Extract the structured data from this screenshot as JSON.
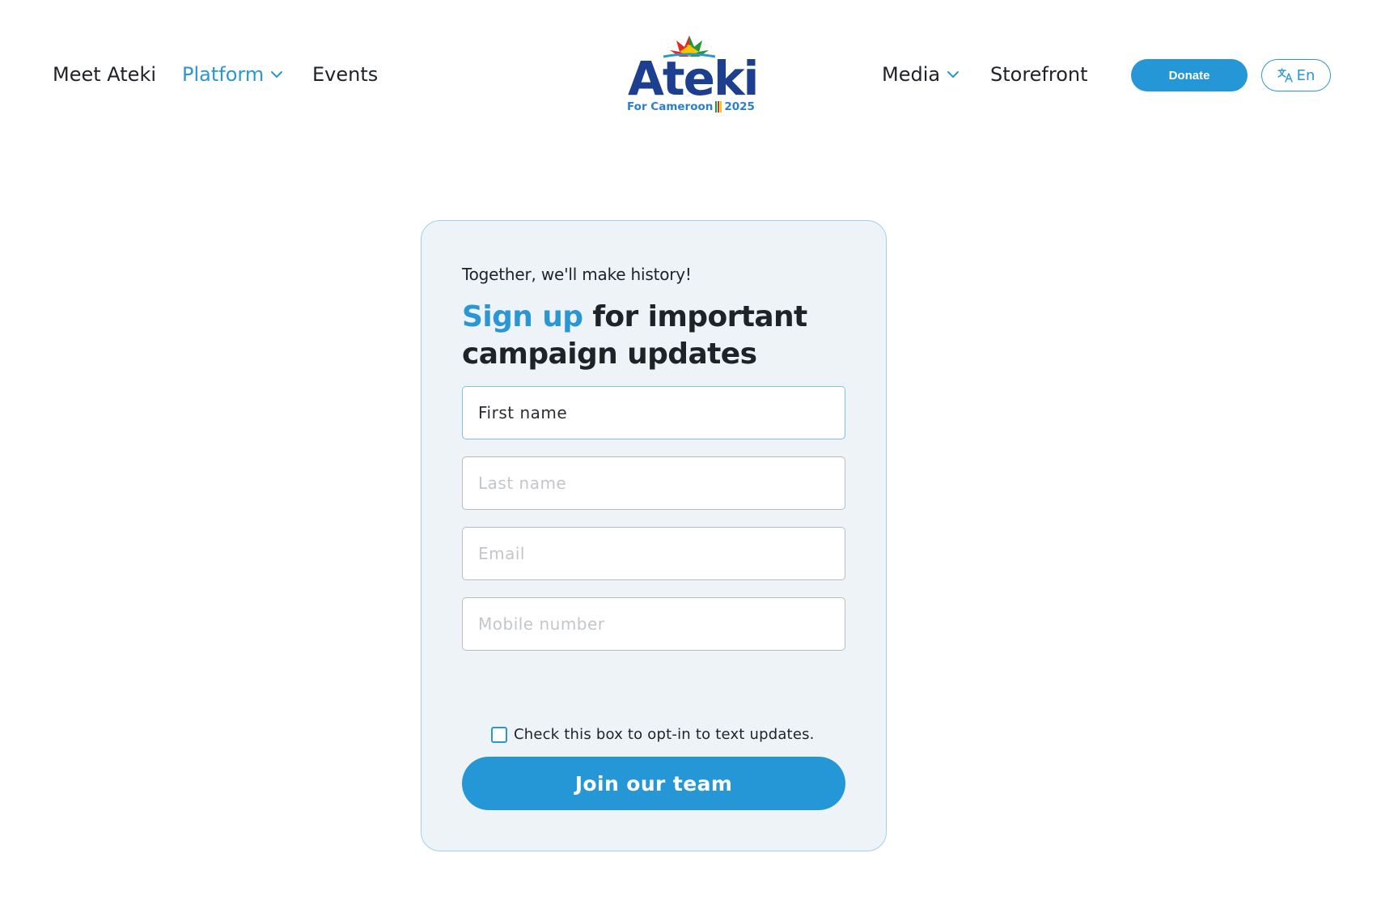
{
  "nav": {
    "left": [
      {
        "label": "Meet Ateki"
      },
      {
        "label": "Platform"
      },
      {
        "label": "Events"
      }
    ],
    "right": [
      {
        "label": "Media"
      },
      {
        "label": "Storefront"
      }
    ],
    "donate_label": "Donate",
    "language_label": "En"
  },
  "logo": {
    "word": "Ateki",
    "subtitle": "For Cameroon",
    "year": "2025"
  },
  "signup": {
    "kicker": "Together, we'll make history!",
    "headline_accent": "Sign up",
    "headline_rest": " for important campaign updates",
    "fields": {
      "first_name_placeholder": "First name",
      "last_name_placeholder": "Last name",
      "email_placeholder": "Email",
      "mobile_placeholder": "Mobile number"
    },
    "optin_label": "Check this box to opt-in to text updates.",
    "submit_label": "Join our team"
  },
  "colors": {
    "accent": "#2596d6",
    "card_background": "#eef3f7",
    "card_border": "#9fd0ec",
    "text": "#1f2329"
  }
}
